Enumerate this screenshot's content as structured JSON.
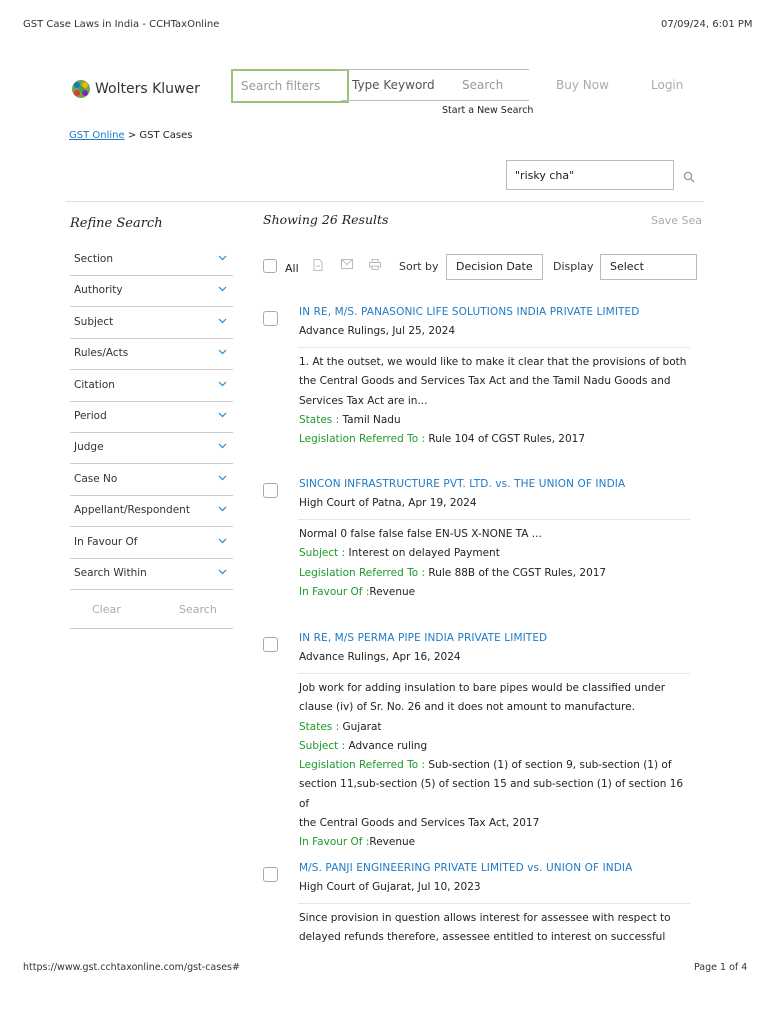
{
  "print_header": {
    "title": "GST Case Laws in India - CCHTaxOnline",
    "datetime": "07/09/24, 6:01 PM"
  },
  "brand": {
    "name": "Wolters Kluwer"
  },
  "search": {
    "filters_placeholder": "Search filters",
    "keyword_placeholder": "Type Keyword",
    "search_label": "Search",
    "new_search": "Start a New Search"
  },
  "nav": {
    "buy_now": "Buy Now",
    "login": "Login"
  },
  "breadcrumb": {
    "home": "GST Online",
    "sep": " > ",
    "current": "GST Cases"
  },
  "query": {
    "value": "\"risky cha\""
  },
  "refine": {
    "title": "Refine Search",
    "filters": [
      "Section",
      "Authority",
      "Subject",
      "Rules/Acts",
      "Citation",
      "Period",
      "Judge",
      "Case No",
      "Appellant/Respondent",
      "In Favour Of",
      "Search Within"
    ],
    "clear": "Clear",
    "search": "Search"
  },
  "results_header": {
    "showing": "Showing 26 Results",
    "save": "Save Sea"
  },
  "toolbar": {
    "all": "All",
    "sort_by": "Sort by",
    "sort_value": "Decision Date",
    "display": "Display",
    "display_value": "Select"
  },
  "results": [
    {
      "title": "IN RE, M/S. PANASONIC LIFE SOLUTIONS INDIA PRIVATE LIMITED",
      "meta": "Advance Rulings, Jul 25, 2024",
      "lines": [
        {
          "label": "",
          "text": "1. At the outset, we would like to make it clear that the provisions of both"
        },
        {
          "label": "",
          "text": "the Central Goods and Services Tax Act and the Tamil Nadu Goods and"
        },
        {
          "label": "",
          "text": "Services Tax Act are in..."
        },
        {
          "label": "States : ",
          "text": "Tamil Nadu"
        },
        {
          "label": "Legislation Referred To : ",
          "text": "Rule 104 of CGST Rules, 2017"
        }
      ]
    },
    {
      "title": "SINCON INFRASTRUCTURE PVT. LTD. vs. THE UNION OF INDIA",
      "meta": "High Court of Patna, Apr 19, 2024",
      "lines": [
        {
          "label": "",
          "text": "Normal 0 false false false EN-US X-NONE TA ..."
        },
        {
          "label": "Subject : ",
          "text": "Interest on delayed Payment"
        },
        {
          "label": "Legislation Referred To : ",
          "text": "Rule 88B of the CGST Rules, 2017"
        },
        {
          "label": "In Favour Of :",
          "text": "Revenue"
        }
      ]
    },
    {
      "title": "IN RE, M/S PERMA PIPE INDIA PRIVATE LIMITED",
      "meta": "Advance Rulings, Apr 16, 2024",
      "lines": [
        {
          "label": "",
          "text": "Job work for adding insulation to bare pipes would be classified under"
        },
        {
          "label": "",
          "text": "clause (iv) of Sr. No. 26 and it does not amount to manufacture."
        },
        {
          "label": "States : ",
          "text": "Gujarat"
        },
        {
          "label": "Subject : ",
          "text": "Advance ruling"
        },
        {
          "label": "Legislation Referred To : ",
          "text": "Sub-section (1) of section 9, sub-section (1) of"
        },
        {
          "label": "",
          "text": "section 11,sub-section (5) of section 15 and sub-section (1) of section 16 of"
        },
        {
          "label": "",
          "text": "the Central Goods and Services Tax Act, 2017"
        },
        {
          "label": "In Favour Of :",
          "text": "Revenue"
        }
      ]
    },
    {
      "title": "M/S. PANJI ENGINEERING PRIVATE LIMITED vs. UNION OF INDIA",
      "meta": "High Court of Gujarat, Jul 10, 2023",
      "lines": [
        {
          "label": "",
          "text": "Since provision in question allows interest for assessee with respect to"
        },
        {
          "label": "",
          "text": "delayed refunds therefore, assessee entitled to interest on successful"
        }
      ]
    }
  ],
  "footer": {
    "url": "https://www.gst.cchtaxonline.com/gst-cases#",
    "page": "Page 1 of 4"
  },
  "colors": {
    "link": "#1d7ac8",
    "label_green": "#1e9a2a",
    "chevron": "#1d8ad8",
    "filter_border": "#9bc27a"
  }
}
